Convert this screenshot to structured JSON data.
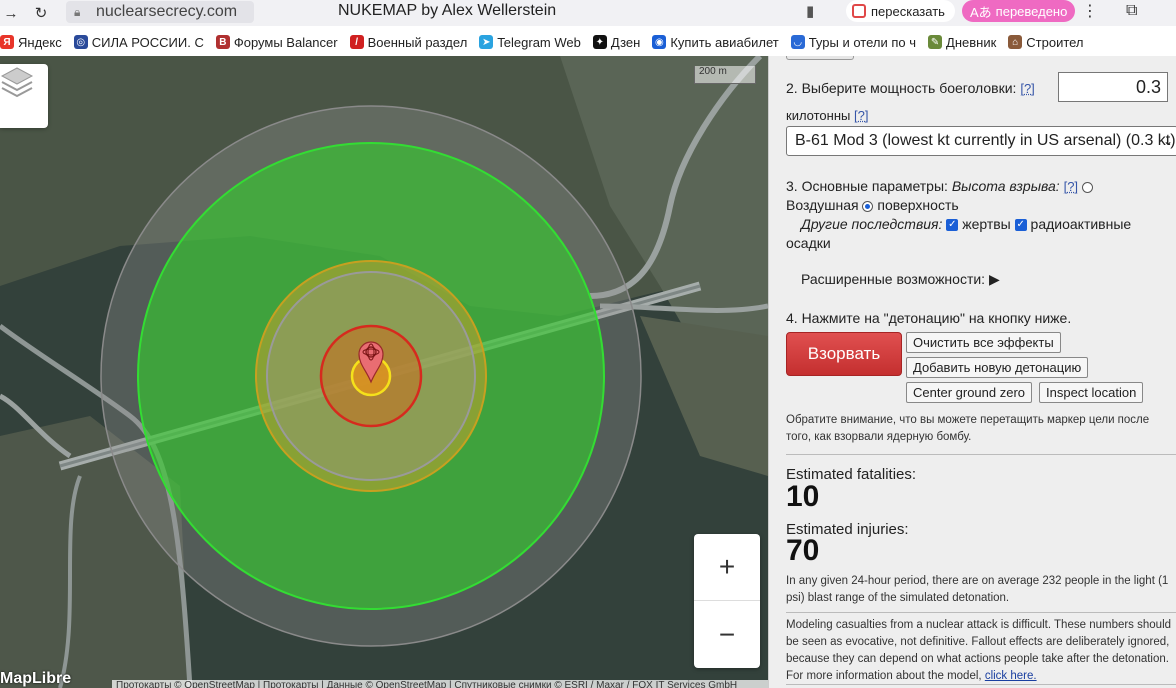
{
  "browser": {
    "url": "nuclearsecrecy.com",
    "title": "NUKEMAP by Alex Wellerstein",
    "retell_label": "пересказать",
    "translated_label": "переведено",
    "translated_icon": "Aあ"
  },
  "bookmarks": [
    {
      "label": "Яндекс",
      "icon": "Я",
      "color": "#e8352a"
    },
    {
      "label": "СИЛА РОССИИ. С",
      "icon": "◎",
      "color": "#2a4a9a"
    },
    {
      "label": "Форумы Balancer",
      "icon": "B",
      "color": "#b03030"
    },
    {
      "label": "Военный раздел",
      "icon": "/",
      "color": "#d02020"
    },
    {
      "label": "Telegram Web",
      "icon": "➤",
      "color": "#2aa3e0"
    },
    {
      "label": "Дзен",
      "icon": "✦",
      "color": "#111111"
    },
    {
      "label": "Купить авиабилет",
      "icon": "◉",
      "color": "#1a5fd6"
    },
    {
      "label": "Туры и отели по ч",
      "icon": "◡",
      "color": "#2a6ad6"
    },
    {
      "label": "Дневник",
      "icon": "✎",
      "color": "#6a8a3a"
    },
    {
      "label": "Строител",
      "icon": "⌂",
      "color": "#8a5a3a"
    }
  ],
  "map": {
    "scale_label": "200 m",
    "zoom_in": "+",
    "zoom_out": "−",
    "logo": "MapLibre",
    "attribution": "Протокарты © OpenStreetMap | Протокарты | Данные © OpenStreetMap | Спутниковые снимки © ESRI / Maxar / FOX IT Services GmbH"
  },
  "panel": {
    "step2_label": "2. Выберите мощность боеголовки:",
    "help": "[?]",
    "yield_value": "0.3",
    "kilotons_label": "килотонны",
    "preset_selected": "B-61 Mod 3 (lowest kt currently in US arsenal) (0.3 kt)",
    "step3_label": "3. Основные параметры:",
    "burst_height_label": "Высота взрыва:",
    "airburst_label": "Воздушная",
    "surface_label": "поверхность",
    "other_effects_label": "Другие последствия:",
    "casualties_label": "жертвы",
    "fallout_label": "радиоактивные",
    "fallout_label2": "осадки",
    "advanced_label": "Расширенные возможности:",
    "advanced_arrow": "▶",
    "step4_label": "4. Нажмите на \"детонацию\" на кнопку ниже.",
    "detonate": "Взорвать",
    "clear_effects": "Очистить все эффекты",
    "add_detonation": "Добавить новую детонацию",
    "center_gz": "Center ground zero",
    "inspect_location": "Inspect location",
    "drag_note_1": "Обратите внимание, что вы можете перетащить маркер цели после",
    "drag_note_2": "того, как взорвали ядерную бомбу.",
    "fatalities_label": "Estimated fatalities:",
    "fatalities_value": "10",
    "injuries_label": "Estimated injuries:",
    "injuries_value": "70",
    "population_note_1": "In any given 24-hour period, there are on average 232 people in the light (1",
    "population_note_2": "psi) blast range of the simulated detonation.",
    "modeling_note_1": "Modeling casualties from a nuclear attack is difficult. These numbers should",
    "modeling_note_2": "be seen as evocative, not definitive. Fallout effects are deliberately ignored,",
    "modeling_note_3": "because they can depend on what actions people take after the detonation.",
    "modeling_note_4": "For more information about the model,",
    "click_here": "click here."
  }
}
